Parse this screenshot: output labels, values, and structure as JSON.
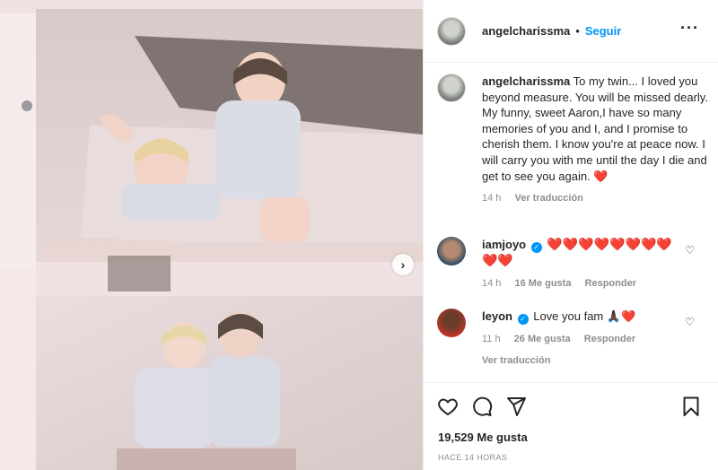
{
  "post": {
    "username": "angelcharissma",
    "follow_label": "Seguir",
    "more_icon": "more-horizontal-icon",
    "caption_username": "angelcharissma",
    "caption_text": "To my twin... I loved you beyond measure. You will be missed dearly. My funny, sweet Aaron,I have so many memories of you and I, and I promise to cherish them. I know you're at peace now. I will carry you with me until the day I die and get to see you again. ❤️",
    "caption_time": "14 h",
    "caption_translate": "Ver traducción",
    "likes": "19,529 Me gusta",
    "time_ago": "HACE 14 HORAS"
  },
  "comments": [
    {
      "username": "iamjoyo",
      "verified": true,
      "text": "❤️❤️❤️❤️❤️❤️❤️❤️❤️❤️",
      "time": "14 h",
      "likes": "16 Me gusta",
      "reply": "Responder"
    },
    {
      "username": "leyon",
      "verified": true,
      "text": "Love you fam 🙏🏿❤️",
      "time": "11 h",
      "likes": "26 Me gusta",
      "reply": "Responder",
      "translate": "Ver traducción"
    }
  ],
  "icons": {
    "like": "heart-icon",
    "comment": "comment-icon",
    "share": "send-icon",
    "save": "bookmark-icon",
    "next": "chevron-right-icon"
  },
  "colors": {
    "follow_blue": "#0095f6",
    "heart_red": "#ed2e3c",
    "muted": "#8e8e8e"
  }
}
